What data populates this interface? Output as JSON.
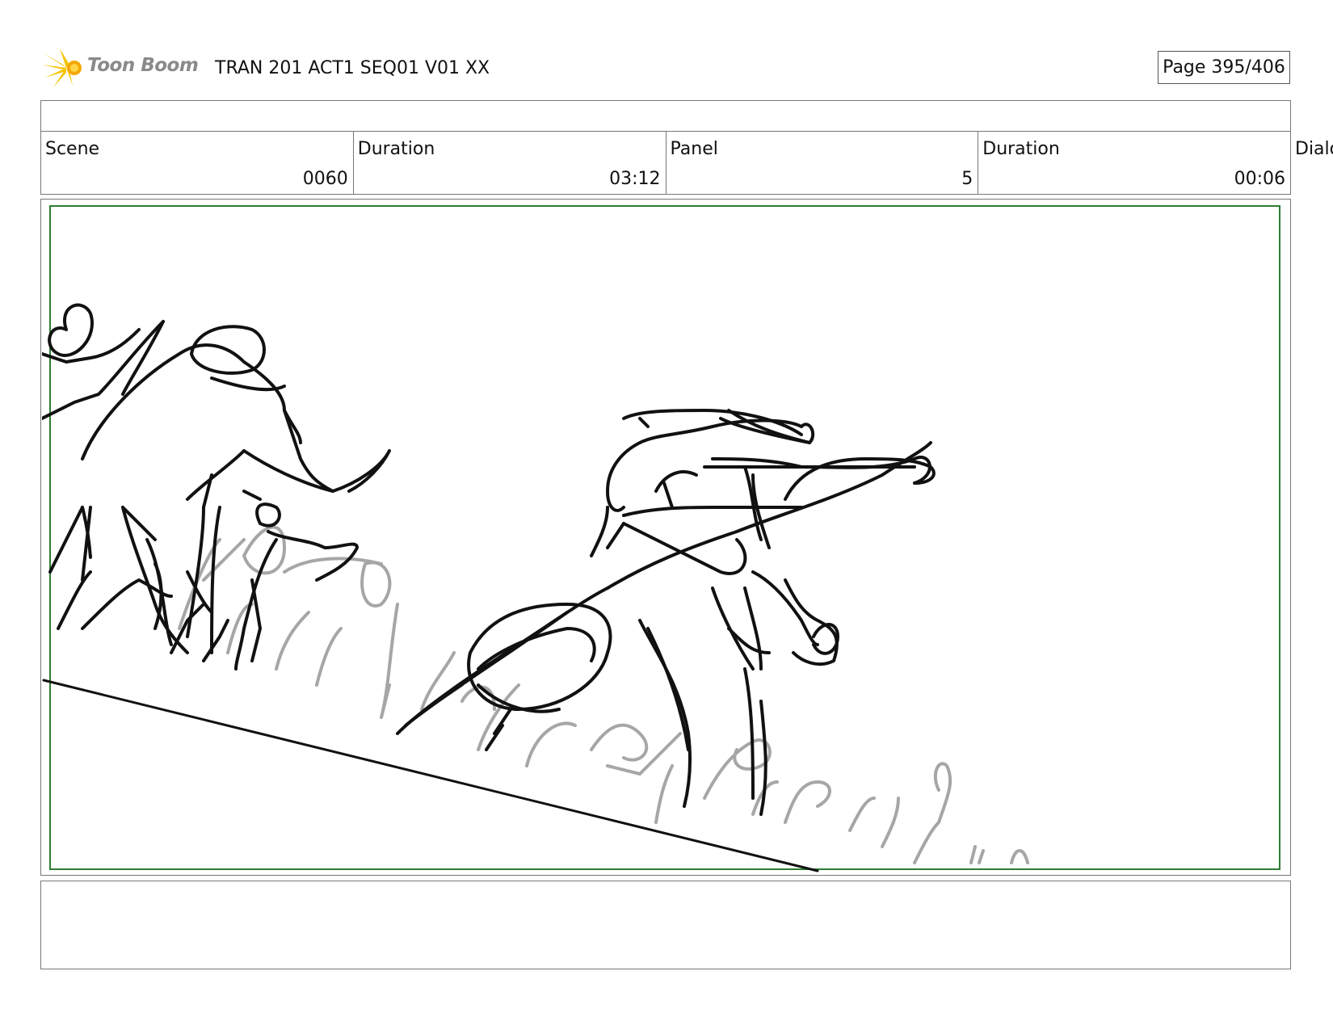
{
  "header": {
    "brand": "Toon Boom",
    "title": "TRAN 201 ACT1 SEQ01 V01 XX",
    "page": "Page 395/406"
  },
  "info": {
    "scene_label": "Scene",
    "scene_value": "0060",
    "scene_duration_label": "Duration",
    "scene_duration_value": "03:12",
    "panel_label": "Panel",
    "panel_value": "5",
    "panel_duration_label": "Duration",
    "panel_duration_value": "00:06",
    "dialog_label": "Dialo"
  },
  "notes": {
    "text": ""
  },
  "colors": {
    "panel_border": "#2e7d32",
    "brand_star": "#f5c400",
    "brand_text": "#8a8a8a"
  }
}
